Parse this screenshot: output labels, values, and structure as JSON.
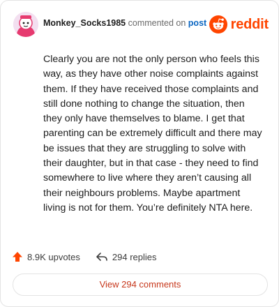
{
  "comment": {
    "author": "Monkey_Socks1985",
    "action_text": "commented on",
    "target_link": "post",
    "body": "Clearly you are not the only person who feels this way, as they have other noise complaints against them. If they have received those complaints and still done nothing to change the situation, then they only have themselves to blame. I get that parenting can be extremely difficult and there may be issues that they are struggling to solve with their daughter, but in that case - they need to find somewhere to live where they aren’t causing all their neighbours problems. Maybe apartment living is not for them. You’re definitely NTA here."
  },
  "brand": {
    "name": "reddit",
    "color": "#ff4500",
    "icon": "reddit-logo-icon"
  },
  "stats": {
    "upvotes": "8.9K upvotes",
    "replies": "294 replies",
    "upvote_icon": "upvote-arrow-icon",
    "reply_icon": "reply-arrow-icon"
  },
  "view_comments_label": "View 294 comments",
  "colors": {
    "accent": "#ff4500",
    "link": "#0a66c2",
    "button_text": "#c7381c"
  }
}
